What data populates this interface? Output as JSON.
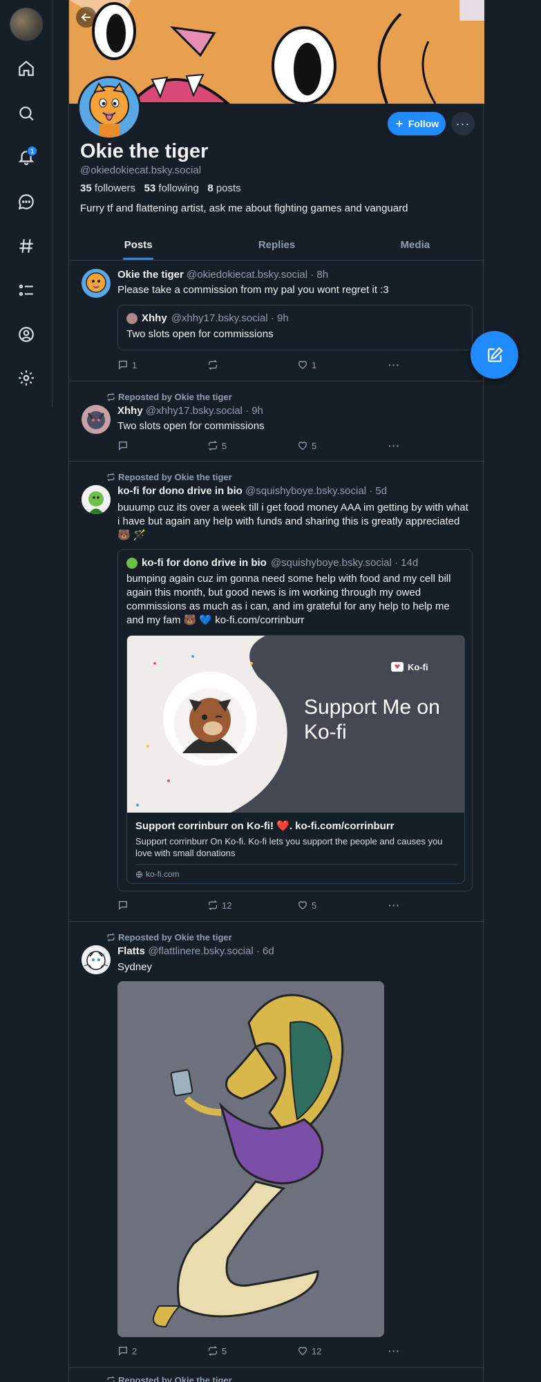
{
  "nav": {
    "notifications_badge": "1"
  },
  "profile": {
    "display_name": "Okie the tiger",
    "handle": "@okiedokiecat.bsky.social",
    "followers_count": "35",
    "followers_label": "followers",
    "following_count": "53",
    "following_label": "following",
    "posts_count": "8",
    "posts_label": "posts",
    "bio": "Furry tf and flattening artist, ask me about fighting games and vanguard",
    "follow_label": "Follow",
    "more_label": "···"
  },
  "tabs": [
    {
      "label": "Posts",
      "active": true
    },
    {
      "label": "Replies"
    },
    {
      "label": "Media"
    }
  ],
  "posts": [
    {
      "author": "Okie the tiger",
      "handle": "@okiedokiecat.bsky.social · 8h",
      "text": "Please take a commission from my pal you wont regret it :3",
      "quote": {
        "author": "Xhhy",
        "handle": "@xhhy17.bsky.social · 9h",
        "text": "Two slots open for commissions"
      },
      "replies": "1",
      "reposts": "",
      "likes": "1"
    },
    {
      "reposted_by": "Reposted by Okie the tiger",
      "author": "Xhhy",
      "handle": "@xhhy17.bsky.social · 9h",
      "text": "Two slots open for commissions",
      "replies": "",
      "reposts": "5",
      "likes": "5"
    },
    {
      "reposted_by": "Reposted by Okie the tiger",
      "author": "ko-fi for dono drive in bio",
      "handle": "@squishyboye.bsky.social · 5d",
      "text": "buuump cuz its over a week till i get food money AAA im getting by with what i have but again any help with funds and sharing this is greatly appreciated 🐻 🪄",
      "quote": {
        "author": "ko-fi for dono drive in bio",
        "handle": "@squishyboye.bsky.social · 14d",
        "text": "bumping again cuz im gonna need some help with food and my cell bill again this month, but good news is im working through my owed commissions as much as i can, and im grateful for any help to help me and my fam 🐻 💙 ko-fi.com/corrinburr",
        "card": {
          "image_heading": "Support Me on Ko-fi",
          "image_brand": "Ko-fi",
          "title": "Support corrinburr on Ko-fi! ❤️. ko-fi.com/corrinburr",
          "description": "Support corrinburr On Ko-fi. Ko-fi lets you support the people and causes you love with small donations",
          "domain": "ko-fi.com"
        }
      },
      "replies": "",
      "reposts": "12",
      "likes": "5"
    },
    {
      "reposted_by": "Reposted by Okie the tiger",
      "author": "Flatts",
      "handle": "@flattlinere.bsky.social · 6d",
      "text": "Sydney",
      "replies": "2",
      "reposts": "5",
      "likes": "12"
    },
    {
      "reposted_by": "Reposted by Okie the tiger"
    }
  ],
  "colors": {
    "accent": "#208bfe",
    "background": "#161e27",
    "border": "#2e4052",
    "muted": "#8f9fb1"
  }
}
